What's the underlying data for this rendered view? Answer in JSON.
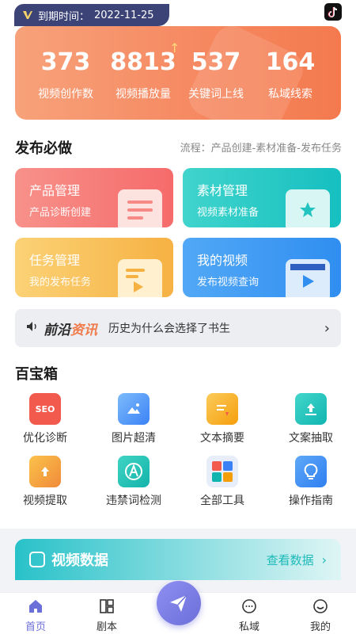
{
  "header": {
    "expire_label": "到期时间：",
    "expire_date": "2022-11-25"
  },
  "stats": [
    {
      "value": "373",
      "label": "视频创作数"
    },
    {
      "value": "8813",
      "label": "视频播放量"
    },
    {
      "value": "537",
      "label": "关键词上线"
    },
    {
      "value": "164",
      "label": "私域线索"
    }
  ],
  "publish": {
    "title": "发布必做",
    "flow": "流程：产品创建-素材准备-发布任务",
    "cards": [
      {
        "title": "产品管理",
        "sub": "产品诊断创建",
        "color": "#f66b6b"
      },
      {
        "title": "素材管理",
        "sub": "视频素材准备",
        "color": "#16bfc0"
      },
      {
        "title": "任务管理",
        "sub": "我的发布任务",
        "color": "#f6b143"
      },
      {
        "title": "我的视频",
        "sub": "发布视频查询",
        "color": "#2f8ef0"
      }
    ]
  },
  "news": {
    "tag_a": "前沿",
    "tag_b": "资讯",
    "text": "历史为什么会选择了书生"
  },
  "toolbox": {
    "title": "百宝箱",
    "tools": [
      {
        "label": "优化诊断",
        "icon": "seo-icon",
        "badge": "SEO"
      },
      {
        "label": "图片超清",
        "icon": "image-enhance-icon"
      },
      {
        "label": "文本摘要",
        "icon": "text-summary-icon"
      },
      {
        "label": "文案抽取",
        "icon": "copy-extract-icon"
      },
      {
        "label": "视频提取",
        "icon": "video-extract-icon"
      },
      {
        "label": "违禁词检测",
        "icon": "banned-word-icon"
      },
      {
        "label": "全部工具",
        "icon": "all-tools-icon"
      },
      {
        "label": "操作指南",
        "icon": "guide-icon"
      }
    ]
  },
  "video_data": {
    "title": "视频数据",
    "link": "查看数据"
  },
  "tabbar": [
    {
      "label": "首页"
    },
    {
      "label": "剧本"
    },
    {
      "label": "私域"
    },
    {
      "label": "我的"
    }
  ],
  "colors": {
    "accent": "#6b6fd8",
    "orange": "#f47a4e",
    "teal": "#16bfc0"
  }
}
